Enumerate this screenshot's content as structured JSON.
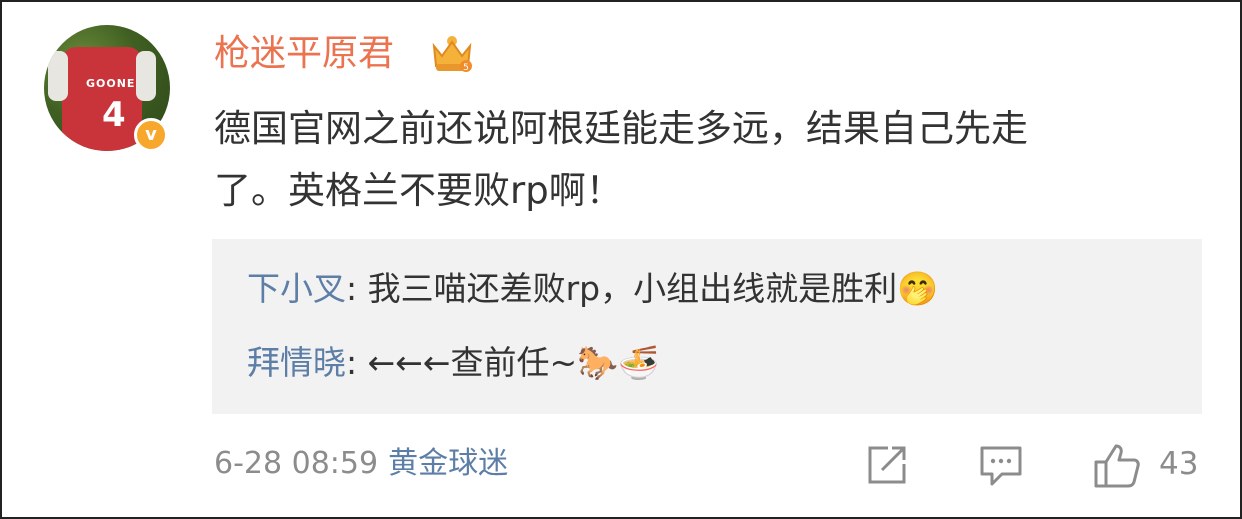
{
  "comment": {
    "username": "枪迷平原君",
    "badge_icon": "crown-badge-icon",
    "verified_icon": "verified-v-icon",
    "avatar_shirt_text": "GOONER",
    "avatar_shirt_number": "4",
    "text_line1": "德国官网之前还说阿根廷能走多远，结果自己先走",
    "text_line2": "了。英格兰不要败rp啊！",
    "timestamp": "6-28 08:59",
    "source": "黄金球迷",
    "like_count": "43"
  },
  "replies": [
    {
      "name": "下小叉",
      "separator": ": ",
      "text": "我三喵还差败rp，小组出线就是胜利",
      "emoji": "🤭"
    },
    {
      "name": "拜情晓",
      "separator": ": ",
      "text": "←←←查前任~",
      "emoji": "🐎🍜"
    }
  ],
  "colors": {
    "username": "#eb7350",
    "reply_name": "#5d7ea6",
    "meta_text": "#8c8c8c",
    "reply_bg": "#f2f2f2",
    "verified": "#f7a82c"
  }
}
